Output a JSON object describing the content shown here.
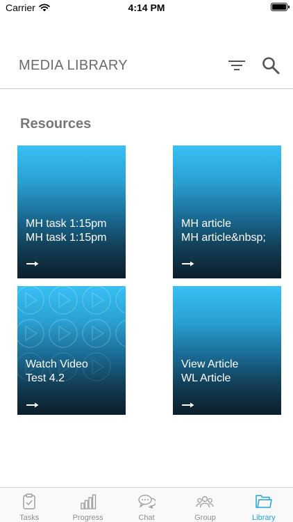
{
  "status_bar": {
    "carrier": "Carrier",
    "time": "4:14 PM"
  },
  "header": {
    "title": "MEDIA LIBRARY",
    "filter_icon": "filter-icon",
    "search_icon": "search-icon"
  },
  "section": {
    "title": "Resources"
  },
  "cards": [
    {
      "line1": "MH task 1:15pm",
      "line2": "MH task 1:15pm",
      "type": "task"
    },
    {
      "line1": "MH article",
      "line2": "MH article&nbsp;",
      "type": "article"
    },
    {
      "line1": "Watch Video",
      "line2": "Test 4.2",
      "type": "video"
    },
    {
      "line1": "View Article",
      "line2": "WL Article",
      "type": "article"
    }
  ],
  "tabs": [
    {
      "label": "Tasks",
      "icon": "clipboard-check-icon",
      "active": false
    },
    {
      "label": "Progress",
      "icon": "bar-chart-icon",
      "active": false
    },
    {
      "label": "Chat",
      "icon": "chat-bubbles-icon",
      "active": false
    },
    {
      "label": "Group",
      "icon": "people-icon",
      "active": false
    },
    {
      "label": "Library",
      "icon": "folder-icon",
      "active": true
    }
  ],
  "colors": {
    "accent": "#1ca4dc",
    "card_top": "#38c0f4",
    "card_bottom": "#0d1e2a",
    "inactive_tab": "#8e8e8e"
  }
}
